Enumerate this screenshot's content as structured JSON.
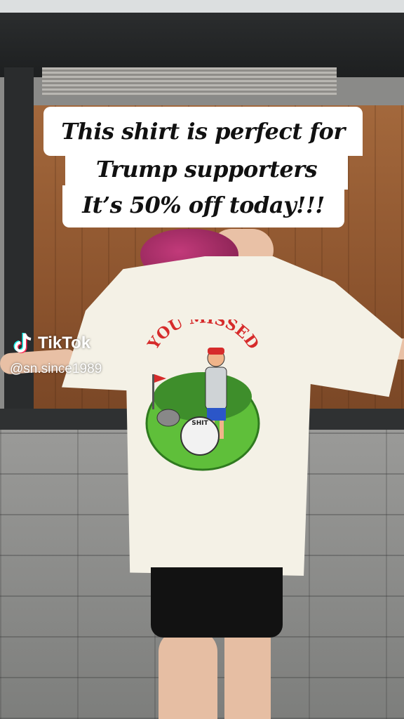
{
  "caption": {
    "line1": "This shirt is perfect for",
    "line2": "Trump supporters",
    "line3": "It’s 50% off today!!!"
  },
  "watermark": {
    "brand": "TikTok",
    "handle": "@sn.since1989"
  },
  "shirt_graphic": {
    "headline": "YOU MISSED",
    "ball_text": "SHIT"
  }
}
